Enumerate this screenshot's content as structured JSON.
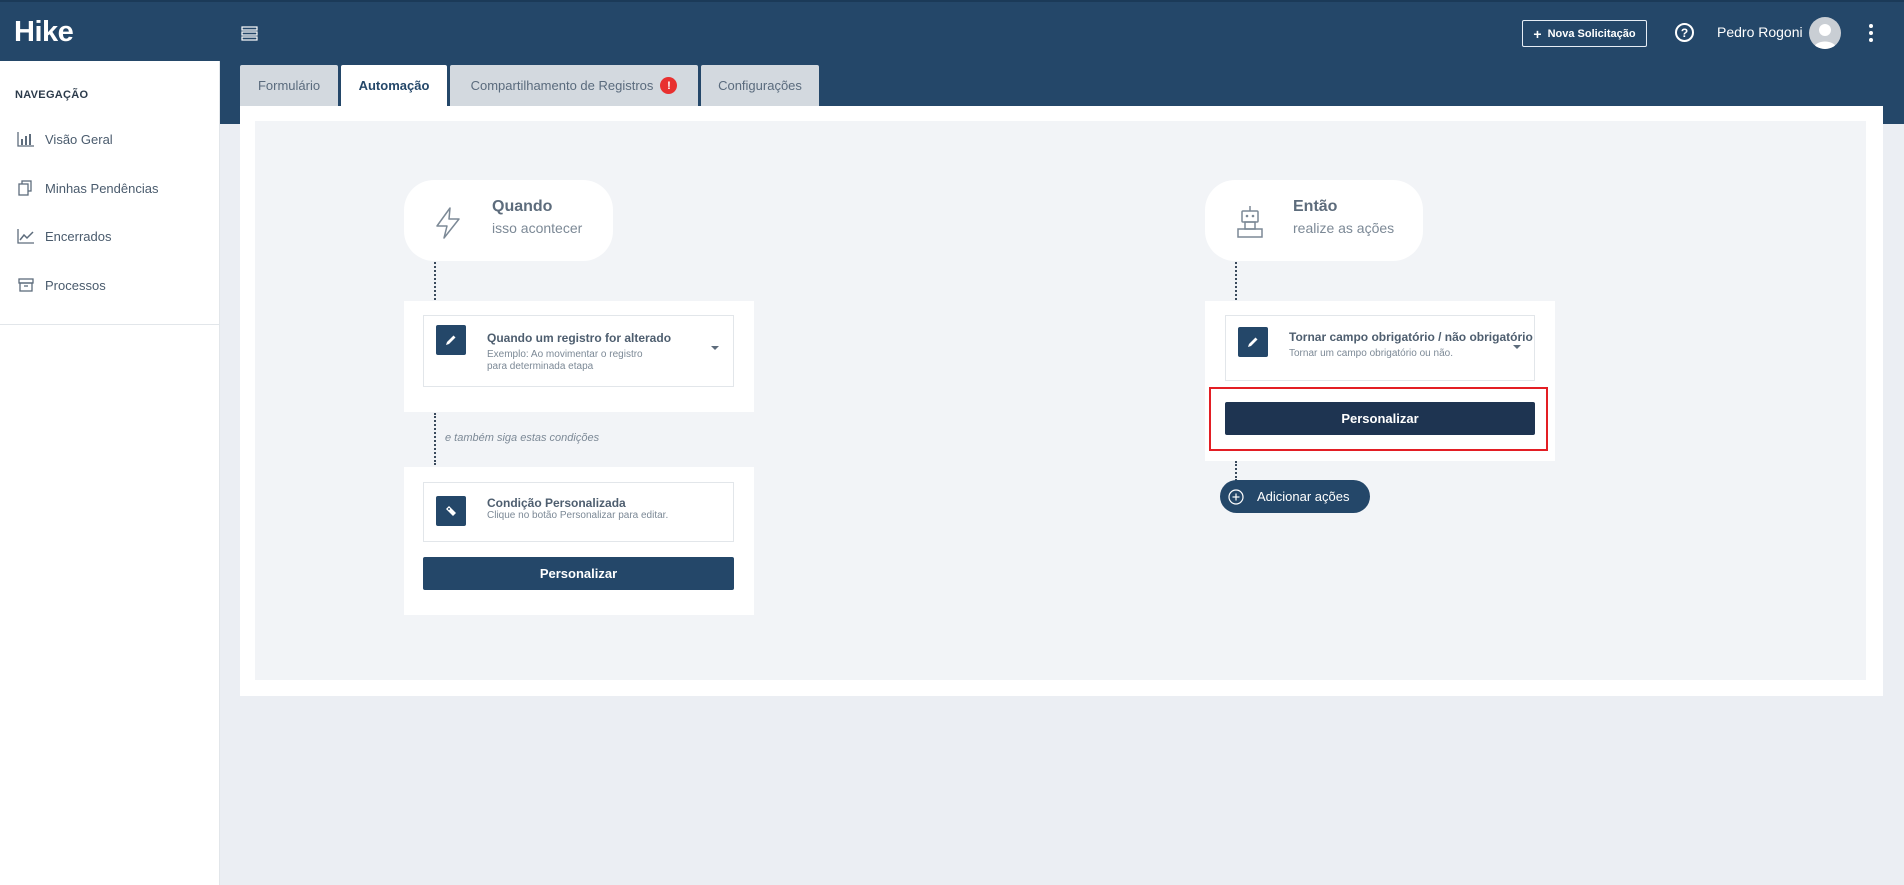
{
  "header": {
    "logo": "Hike",
    "new_request_label": "Nova Solicitação",
    "help_glyph": "?",
    "user_name": "Pedro Rogoni"
  },
  "sidebar": {
    "title": "NAVEGAÇÃO",
    "items": [
      {
        "label": "Visão Geral",
        "icon": "bar-chart-icon"
      },
      {
        "label": "Minhas Pendências",
        "icon": "copy-icon"
      },
      {
        "label": "Encerrados",
        "icon": "line-chart-icon"
      },
      {
        "label": "Processos",
        "icon": "archive-icon"
      }
    ]
  },
  "tabs": [
    {
      "label": "Formulário",
      "active": false
    },
    {
      "label": "Automação",
      "active": true
    },
    {
      "label": "Compartilhamento de Registros",
      "active": false,
      "alert": "!"
    },
    {
      "label": "Configurações",
      "active": false
    }
  ],
  "trigger": {
    "title": "Quando",
    "subtitle": "isso acontecer",
    "rule_title": "Quando um registro for alterado",
    "rule_desc": "Exemplo: Ao movimentar o registro para determinada etapa",
    "conditions_hint": "e também siga estas condições",
    "condition_title": "Condição Personalizada",
    "condition_desc": "Clique no botão Personalizar para editar.",
    "customize_label": "Personalizar"
  },
  "action": {
    "title": "Então",
    "subtitle": "realize as ações",
    "rule_title": "Tornar campo obrigatório / não obrigatório",
    "rule_desc": "Tornar um campo obrigatório ou não.",
    "customize_label": "Personalizar",
    "add_label": "Adicionar ações"
  },
  "colors": {
    "brand": "#244769",
    "highlight": "#e31e24",
    "alert": "#e8302f"
  }
}
